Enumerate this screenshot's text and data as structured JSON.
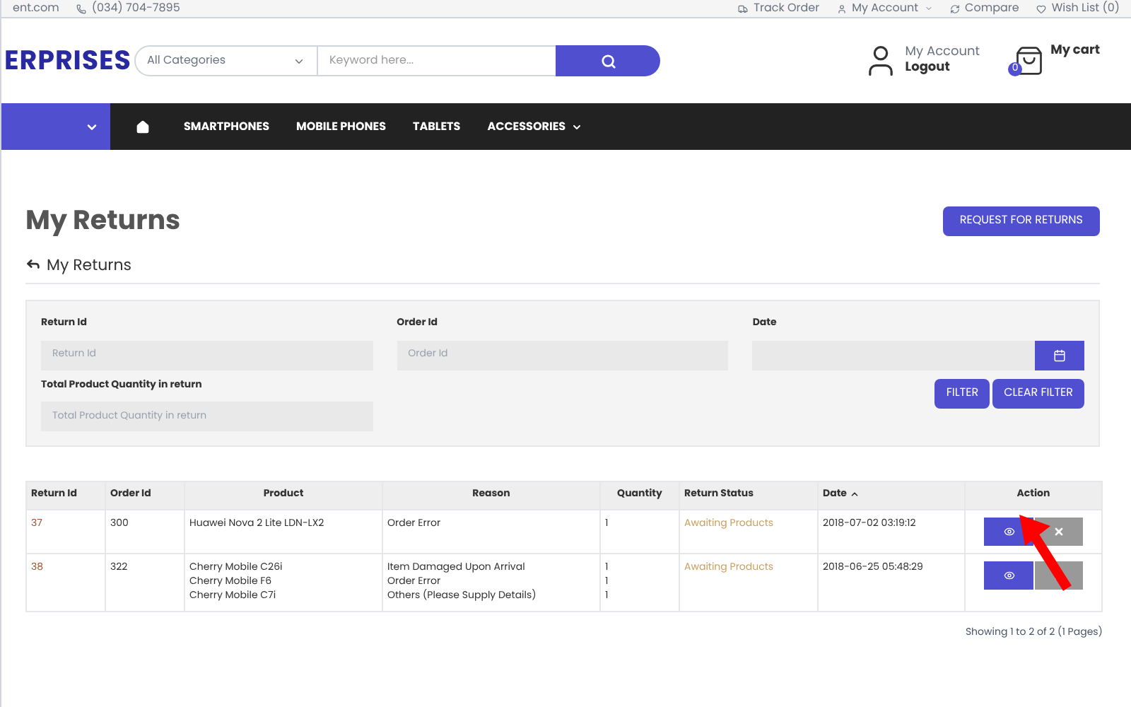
{
  "top_bar": {
    "email": "ent.com",
    "phone": "(034) 704-7895",
    "links": [
      {
        "label": "Track Order",
        "dropdown": false
      },
      {
        "label": "My Account",
        "dropdown": true
      },
      {
        "label": "Compare",
        "dropdown": false
      },
      {
        "label": "Wish List (0)",
        "dropdown": false
      }
    ]
  },
  "header": {
    "logo": "ERPRISES",
    "category": "All Categories",
    "search_placeholder": "Keyword here...",
    "account_label": "My Account",
    "account_action": "Logout",
    "cart_label": "My cart",
    "cart_count": "0"
  },
  "nav": {
    "items": [
      {
        "label": "SMARTPHONES",
        "dropdown": false
      },
      {
        "label": "MOBILE PHONES",
        "dropdown": false
      },
      {
        "label": "TABLETS",
        "dropdown": false
      },
      {
        "label": "ACCESSORIES",
        "dropdown": true
      }
    ]
  },
  "page": {
    "title": "My Returns",
    "request_button": "REQUEST FOR RETURNS",
    "breadcrumb": "My Returns"
  },
  "filter": {
    "fields": [
      {
        "label": "Return Id",
        "placeholder": "Return Id"
      },
      {
        "label": "Order Id",
        "placeholder": "Order Id"
      },
      {
        "label": "Date"
      }
    ],
    "quantity_field": {
      "label": "Total Product Quantity in return",
      "placeholder": "Total Product Quantity in return"
    },
    "buttons": [
      "FILTER",
      "CLEAR FILTER"
    ]
  },
  "table": {
    "columns": [
      {
        "label": "Return Id",
        "sorted": false
      },
      {
        "label": "Order Id",
        "sorted": false
      },
      {
        "label": "Product",
        "sorted": false
      },
      {
        "label": "Reason",
        "sorted": false
      },
      {
        "label": "Quantity",
        "sorted": false
      },
      {
        "label": "Return Status",
        "sorted": false
      },
      {
        "label": "Date",
        "sorted": true
      },
      {
        "label": "Action",
        "sorted": false
      }
    ],
    "rows": [
      {
        "return_id": "37",
        "order_id": "300",
        "products": [
          "Huawei Nova 2 Lite LDN-LX2"
        ],
        "reasons": [
          "Order Error"
        ],
        "quantities": [
          "1"
        ],
        "status": "Awaiting Products",
        "date": "2018-07-02 03:19:12"
      },
      {
        "return_id": "38",
        "order_id": "322",
        "products": [
          "Cherry Mobile C26i",
          "Cherry Mobile F6",
          "Cherry Mobile C7i"
        ],
        "reasons": [
          "Item Damaged Upon Arrival",
          "Order Error",
          "Others (Please Supply Details)"
        ],
        "quantities": [
          "1",
          "1",
          "1"
        ],
        "status": "Awaiting Products",
        "date": "2018-06-25 05:48:29"
      }
    ]
  },
  "pagination": "Showing 1 to 2 of 2 (1 Pages)"
}
